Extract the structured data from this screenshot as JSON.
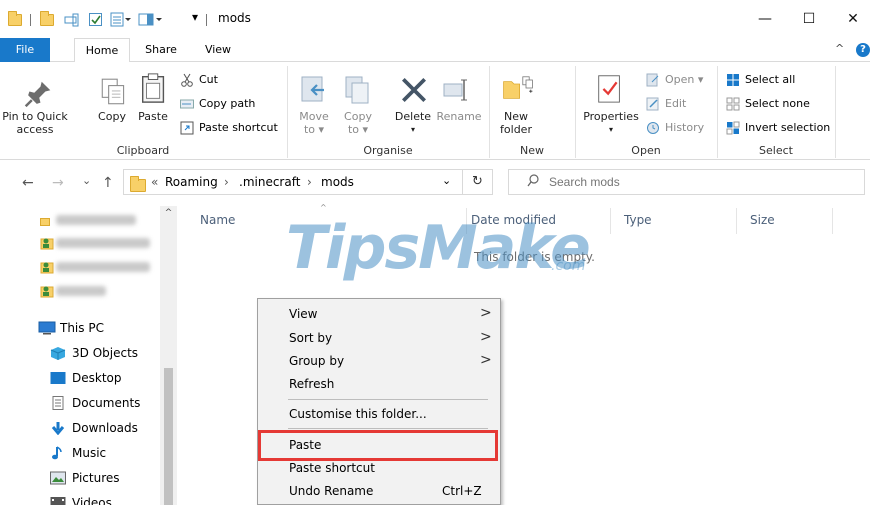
{
  "window": {
    "title": "mods",
    "minimize_glyph": "—",
    "maximize_glyph": "☐",
    "close_glyph": "✕"
  },
  "quick_access": {
    "customize_glyph": "▾"
  },
  "tabs": {
    "file": "File",
    "home": "Home",
    "share": "Share",
    "view": "View",
    "collapse_glyph": "^",
    "help_glyph": "?"
  },
  "ribbon": {
    "clipboard": {
      "group_label": "Clipboard",
      "pin_label_1": "Pin to Quick",
      "pin_label_2": "access",
      "copy_label": "Copy",
      "paste_label": "Paste",
      "cut_label": "Cut",
      "copy_path_label": "Copy path",
      "paste_shortcut_label": "Paste shortcut"
    },
    "organise": {
      "group_label": "Organise",
      "move_to_1": "Move",
      "move_to_2": "to ▾",
      "copy_to_1": "Copy",
      "copy_to_2": "to ▾",
      "delete_label": "Delete",
      "delete_caret": "▾",
      "rename_label": "Rename"
    },
    "new": {
      "group_label": "New",
      "new_folder_1": "New",
      "new_folder_2": "folder"
    },
    "open": {
      "group_label": "Open",
      "properties_label": "Properties",
      "properties_caret": "▾",
      "open_label": "Open ▾",
      "edit_label": "Edit",
      "history_label": "History"
    },
    "select": {
      "group_label": "Select",
      "select_all": "Select all",
      "select_none": "Select none",
      "invert_selection": "Invert selection"
    }
  },
  "address": {
    "back_glyph": "←",
    "forward_glyph": "→",
    "recent_glyph": "⌄",
    "up_glyph": "↑",
    "overflow": "«",
    "crumbs": [
      "Roaming",
      ".minecraft",
      "mods"
    ],
    "sep": "›",
    "dropdown_glyph": "⌄",
    "refresh_glyph": "↻",
    "search_placeholder": "Search mods"
  },
  "navpane": {
    "items": [
      {
        "label": "This PC"
      },
      {
        "label": "3D Objects"
      },
      {
        "label": "Desktop"
      },
      {
        "label": "Documents"
      },
      {
        "label": "Downloads"
      },
      {
        "label": "Music"
      },
      {
        "label": "Pictures"
      },
      {
        "label": "Videos"
      }
    ],
    "scroll_up_glyph": "^"
  },
  "content": {
    "columns": [
      "Name",
      "Date modified",
      "Type",
      "Size"
    ],
    "sort_glyph": "^",
    "empty_message": "This folder is empty."
  },
  "watermark": {
    "text": "TipsMake",
    "suffix": ".com"
  },
  "context_menu": {
    "items": [
      {
        "label": "View",
        "submenu": true
      },
      {
        "label": "Sort by",
        "submenu": true
      },
      {
        "label": "Group by",
        "submenu": true
      },
      {
        "label": "Refresh"
      },
      {
        "label": "Customise this folder..."
      },
      {
        "label": "Paste"
      },
      {
        "label": "Paste shortcut"
      },
      {
        "label": "Undo Rename",
        "shortcut": "Ctrl+Z"
      }
    ],
    "submenu_glyph": ">",
    "highlight_color": "#e53935"
  },
  "colors": {
    "accent": "#1979ca",
    "folder": "#f8d068"
  }
}
